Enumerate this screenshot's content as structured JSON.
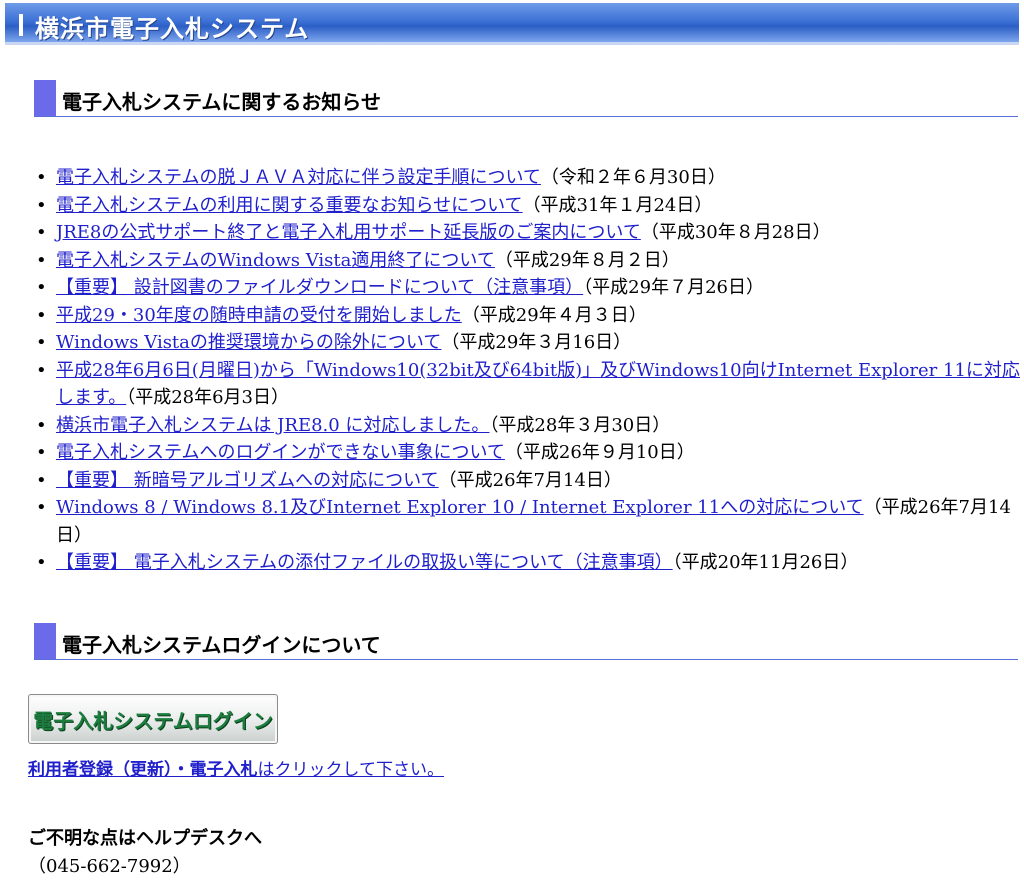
{
  "header": {
    "title": "横浜市電子入札システム"
  },
  "sections": {
    "news_title": "電子入札システムに関するお知らせ",
    "login_title": "電子入札システムログインについて"
  },
  "news": [
    {
      "link": "電子入札システムの脱ＪＡＶＡ対応に伴う設定手順について",
      "date": "（令和２年６月30日）"
    },
    {
      "link": "電子入札システムの利用に関する重要なお知らせについて",
      "date": "（平成31年１月24日）"
    },
    {
      "link": "JRE8の公式サポート終了と電子入札用サポート延長版のご案内について",
      "date": "（平成30年８月28日）"
    },
    {
      "link": "電子入札システムのWindows Vista適用終了について",
      "date": "（平成29年８月２日）"
    },
    {
      "link": "【重要】 設計図書のファイルダウンロードについて（注意事項）",
      "date": "（平成29年７月26日）"
    },
    {
      "link": "平成29・30年度の随時申請の受付を開始しました",
      "date": "（平成29年４月３日）"
    },
    {
      "link": "Windows Vistaの推奨環境からの除外について",
      "date": "（平成29年３月16日）"
    },
    {
      "link": "平成28年6月6日(月曜日)から「Windows10(32bit及び64bit版)」及びWindows10向けInternet Explorer 11に対応します。",
      "date": "（平成28年6月3日）"
    },
    {
      "link": "横浜市電子入札システムは JRE8.0 に対応しました。",
      "date": "（平成28年３月30日）"
    },
    {
      "link": "電子入札システムへのログインができない事象について",
      "date": "（平成26年９月10日）"
    },
    {
      "link": "【重要】 新暗号アルゴリズムへの対応について",
      "date": "（平成26年7月14日）"
    },
    {
      "link": "Windows 8 / Windows 8.1及びInternet Explorer 10 / Internet Explorer 11への対応について",
      "date": "（平成26年7月14日）"
    },
    {
      "link": "【重要】 電子入札システムの添付ファイルの取扱い等について（注意事項）",
      "date": "（平成20年11月26日）"
    }
  ],
  "login": {
    "button_label": "電子入札システムログイン",
    "note_bold": "利用者登録（更新）・電子入札",
    "note_rest": "はクリックして下さい。"
  },
  "help": {
    "line1": "ご不明な点はヘルプデスクへ",
    "line2": "（045-662-7992）"
  },
  "colors": {
    "header_blue": "#3e72d6",
    "section_marker": "#6b6bea",
    "link": "#1f1fcc",
    "login_text": "#1c7d3f"
  }
}
